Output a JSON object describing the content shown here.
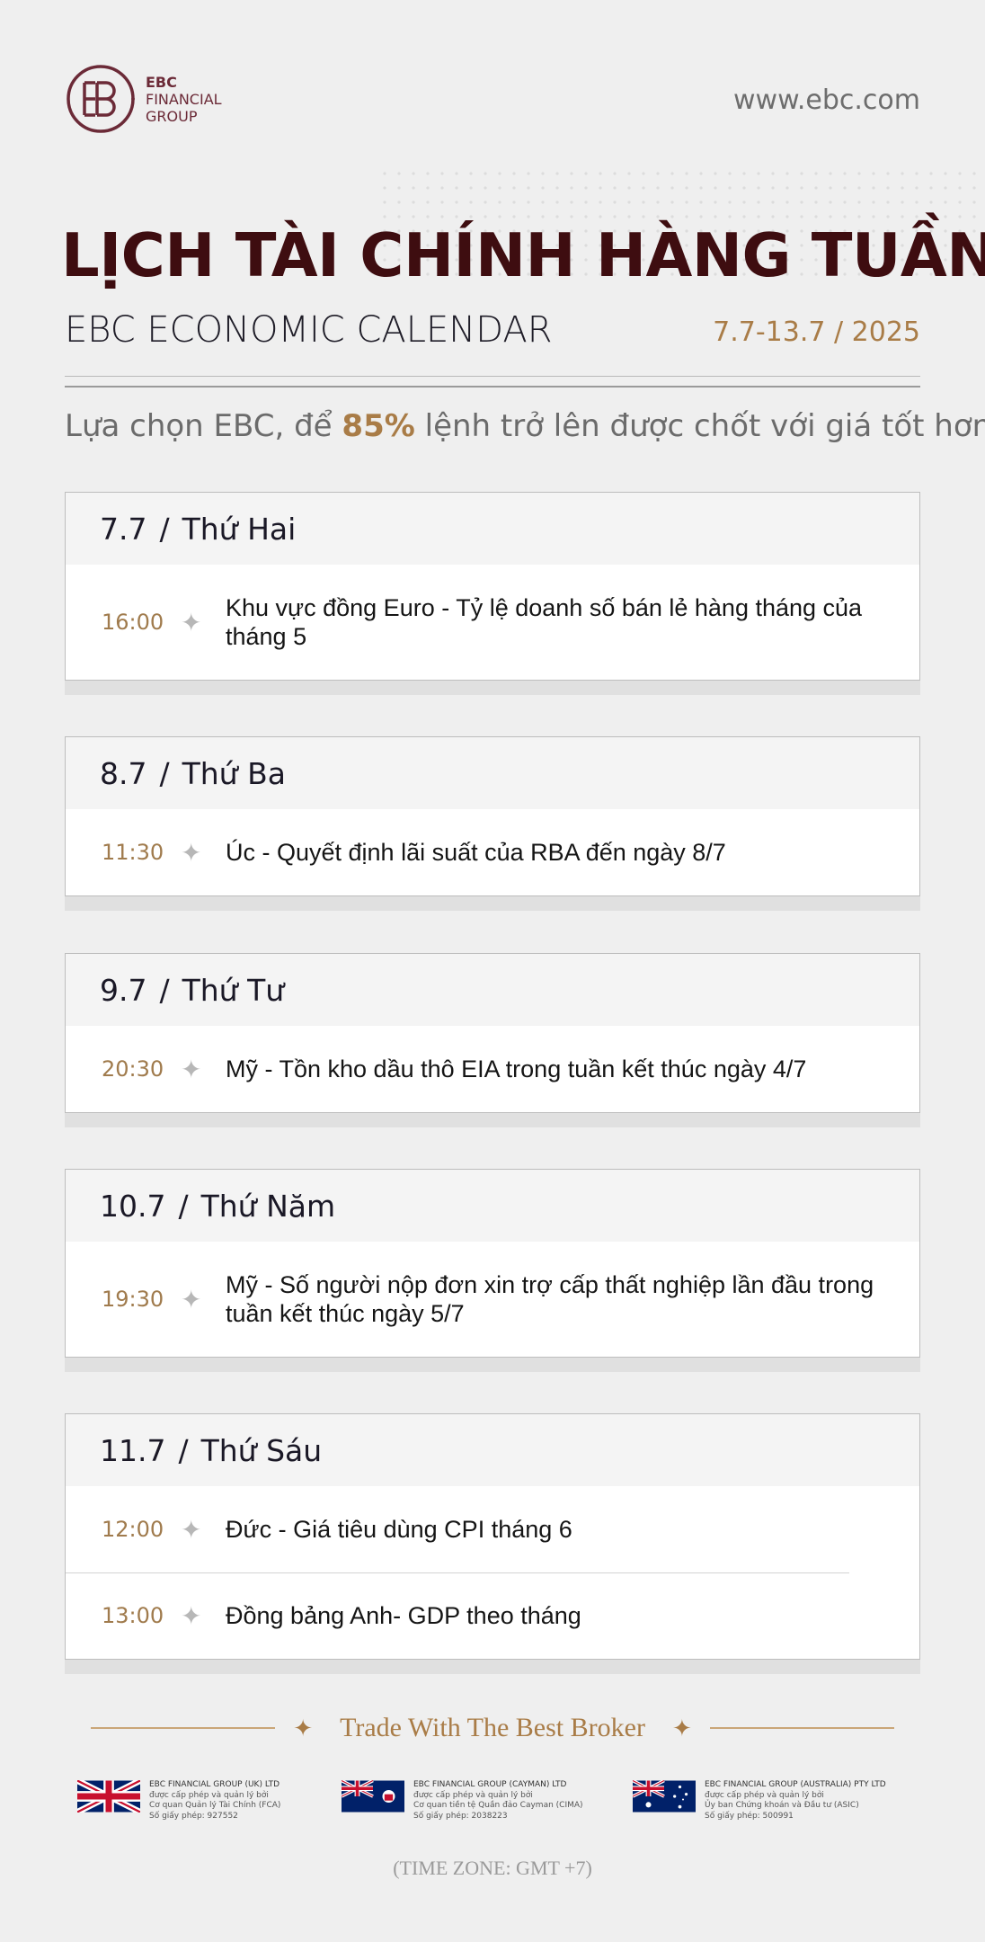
{
  "brand": {
    "logo_lines": [
      "EBC",
      "FINANCIAL",
      "GROUP"
    ],
    "url": "www.ebc.com",
    "color": "#6b2a37"
  },
  "header": {
    "title": "LỊCH TÀI CHÍNH HÀNG TUẦN",
    "subtitle": "EBC ECONOMIC CALENDAR",
    "date_range": "7.7-13.7 / 2025"
  },
  "tagline": {
    "before": "Lựa chọn EBC, để ",
    "highlight": "85%",
    "after": " lệnh trở lên được chốt với giá tốt hơn"
  },
  "days": [
    {
      "date": "7.7",
      "sep": "/",
      "weekday": "Thứ Hai",
      "events": [
        {
          "time": "16:00",
          "text": "Khu vực đồng Euro - Tỷ lệ doanh số bán lẻ hàng tháng của tháng 5"
        }
      ]
    },
    {
      "date": "8.7",
      "sep": "/",
      "weekday": "Thứ Ba",
      "events": [
        {
          "time": "11:30",
          "text": "Úc - Quyết định lãi suất của RBA đến ngày 8/7"
        }
      ]
    },
    {
      "date": "9.7",
      "sep": "/",
      "weekday": "Thứ Tư",
      "events": [
        {
          "time": "20:30",
          "text": "Mỹ - Tồn kho dầu thô EIA trong tuần kết thúc ngày 4/7"
        }
      ]
    },
    {
      "date": "10.7",
      "sep": "/",
      "weekday": "Thứ Năm",
      "events": [
        {
          "time": "19:30",
          "text": "Mỹ - Số người nộp đơn xin trợ cấp thất nghiệp lần đầu trong tuần kết thúc ngày 5/7"
        }
      ]
    },
    {
      "date": "11.7",
      "sep": "/",
      "weekday": "Thứ Sáu",
      "events": [
        {
          "time": "12:00",
          "text": "Đức - Giá tiêu dùng CPI tháng 6"
        },
        {
          "time": "13:00",
          "text": "Đồng bảng Anh- GDP theo tháng"
        }
      ]
    }
  ],
  "footer": {
    "slogan": "Trade With The Best Broker",
    "regulators": [
      {
        "flag": "uk-flag-icon",
        "company": "EBC FINANCIAL GROUP (UK) LTD",
        "line1": "được cấp phép và quản lý bởi",
        "line2": "Cơ quan Quản lý Tài Chính (FCA)",
        "license": "Số giấy phép: 927552"
      },
      {
        "flag": "cayman-flag-icon",
        "company": "EBC FINANCIAL GROUP (CAYMAN) LTD",
        "line1": "được cấp phép và quản lý bởi",
        "line2": "Cơ quan tiền tệ Quần đảo Cayman (CIMA)",
        "license": "Số giấy phép: 2038223"
      },
      {
        "flag": "australia-flag-icon",
        "company": "EBC FINANCIAL GROUP (AUSTRALIA) PTY LTD",
        "line1": "được cấp phép và quản lý bởi",
        "line2": "Ủy ban Chứng khoán và Đầu tư (ASIC)",
        "license": "Số giấy phép: 500991"
      }
    ],
    "timezone": "(TIME ZONE: GMT +7)"
  }
}
